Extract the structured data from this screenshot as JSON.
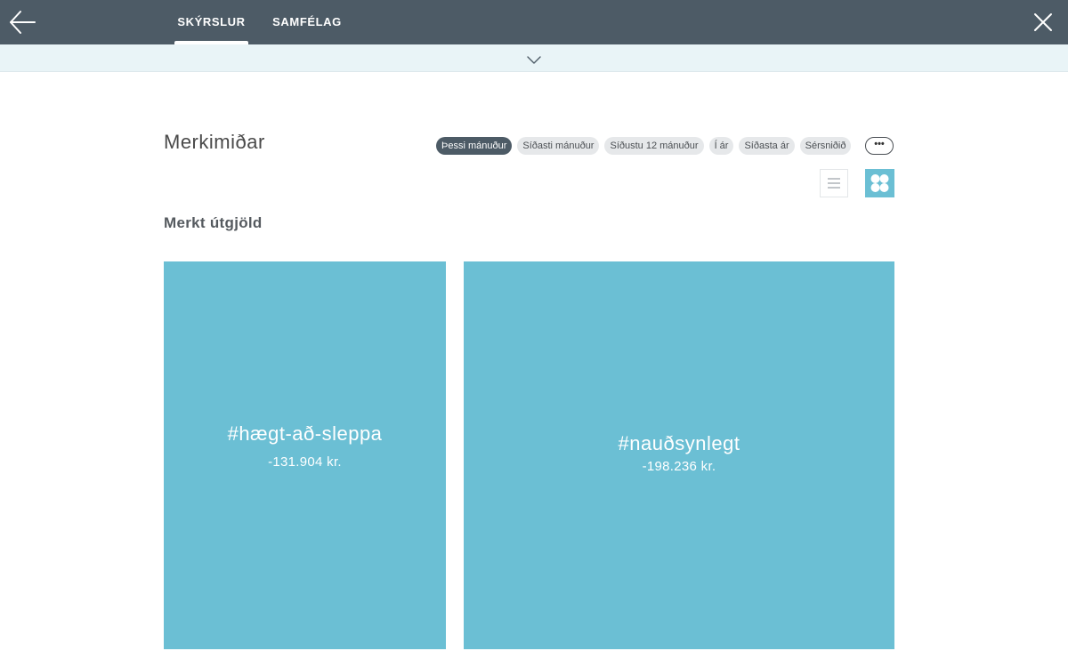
{
  "topbar": {
    "tabs": [
      {
        "label": "SKÝRSLUR",
        "active": true
      },
      {
        "label": "SAMFÉLAG",
        "active": false
      }
    ],
    "back_icon": "arrow-left-icon",
    "close_icon": "close-icon",
    "background_color": "#4d5b66"
  },
  "subbar": {
    "expand_icon": "chevron-down-icon",
    "background_color": "#e9f4f7"
  },
  "page": {
    "title": "Merkimiðar",
    "period_filters": [
      {
        "label": "Þessi mánuður",
        "active": true
      },
      {
        "label": "Síðasti mánuður",
        "active": false
      },
      {
        "label": "Síðustu 12 mánuður",
        "active": false
      },
      {
        "label": "Í ár",
        "active": false
      },
      {
        "label": "Síðasta ár",
        "active": false
      },
      {
        "label": "Sérsniðið",
        "active": false
      }
    ],
    "more_label": "•••",
    "view_toggle": {
      "list_icon": "list-view-icon",
      "grid_icon": "grid-view-icon",
      "selected": "grid"
    },
    "section_title": "Merkt útgjöld",
    "accent_color": "#6bbfd4"
  },
  "tiles": [
    {
      "tag": "#hægt-að-sleppa",
      "amount": "-131.904 kr."
    },
    {
      "tag": "#nauðsynlegt",
      "amount": "-198.236 kr."
    }
  ]
}
